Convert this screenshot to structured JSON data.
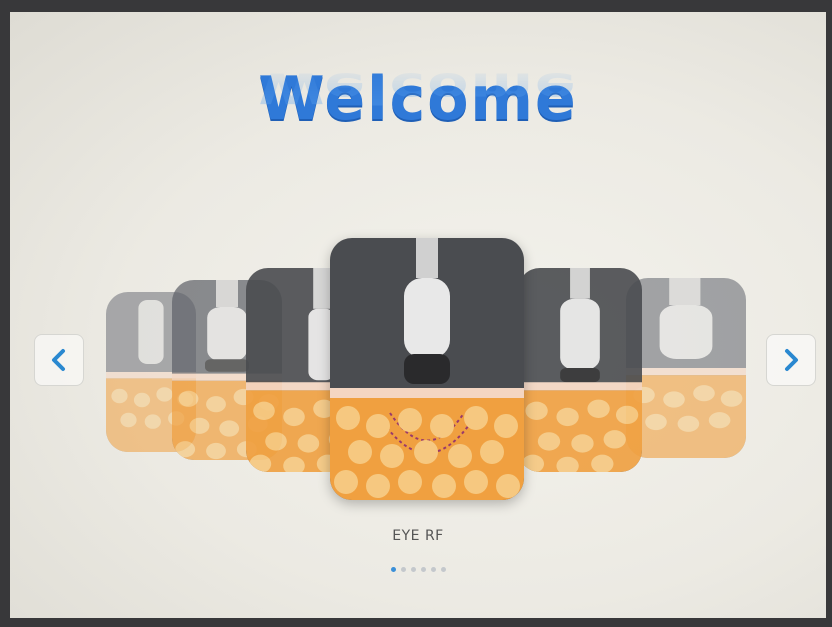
{
  "header": {
    "title": "Welcome"
  },
  "carousel": {
    "caption": "EYE RF",
    "slide_count": 6,
    "active_index": 0,
    "prev_icon": "chevron-left-icon",
    "next_icon": "chevron-right-icon"
  },
  "colors": {
    "title": "#2f79d8",
    "chevron": "#2a88d0",
    "active_dot": "#3a8fd8",
    "inactive_dot": "#c4c8cc",
    "card_bg": "#4a4c50",
    "fat_cells": "#f0a040"
  }
}
